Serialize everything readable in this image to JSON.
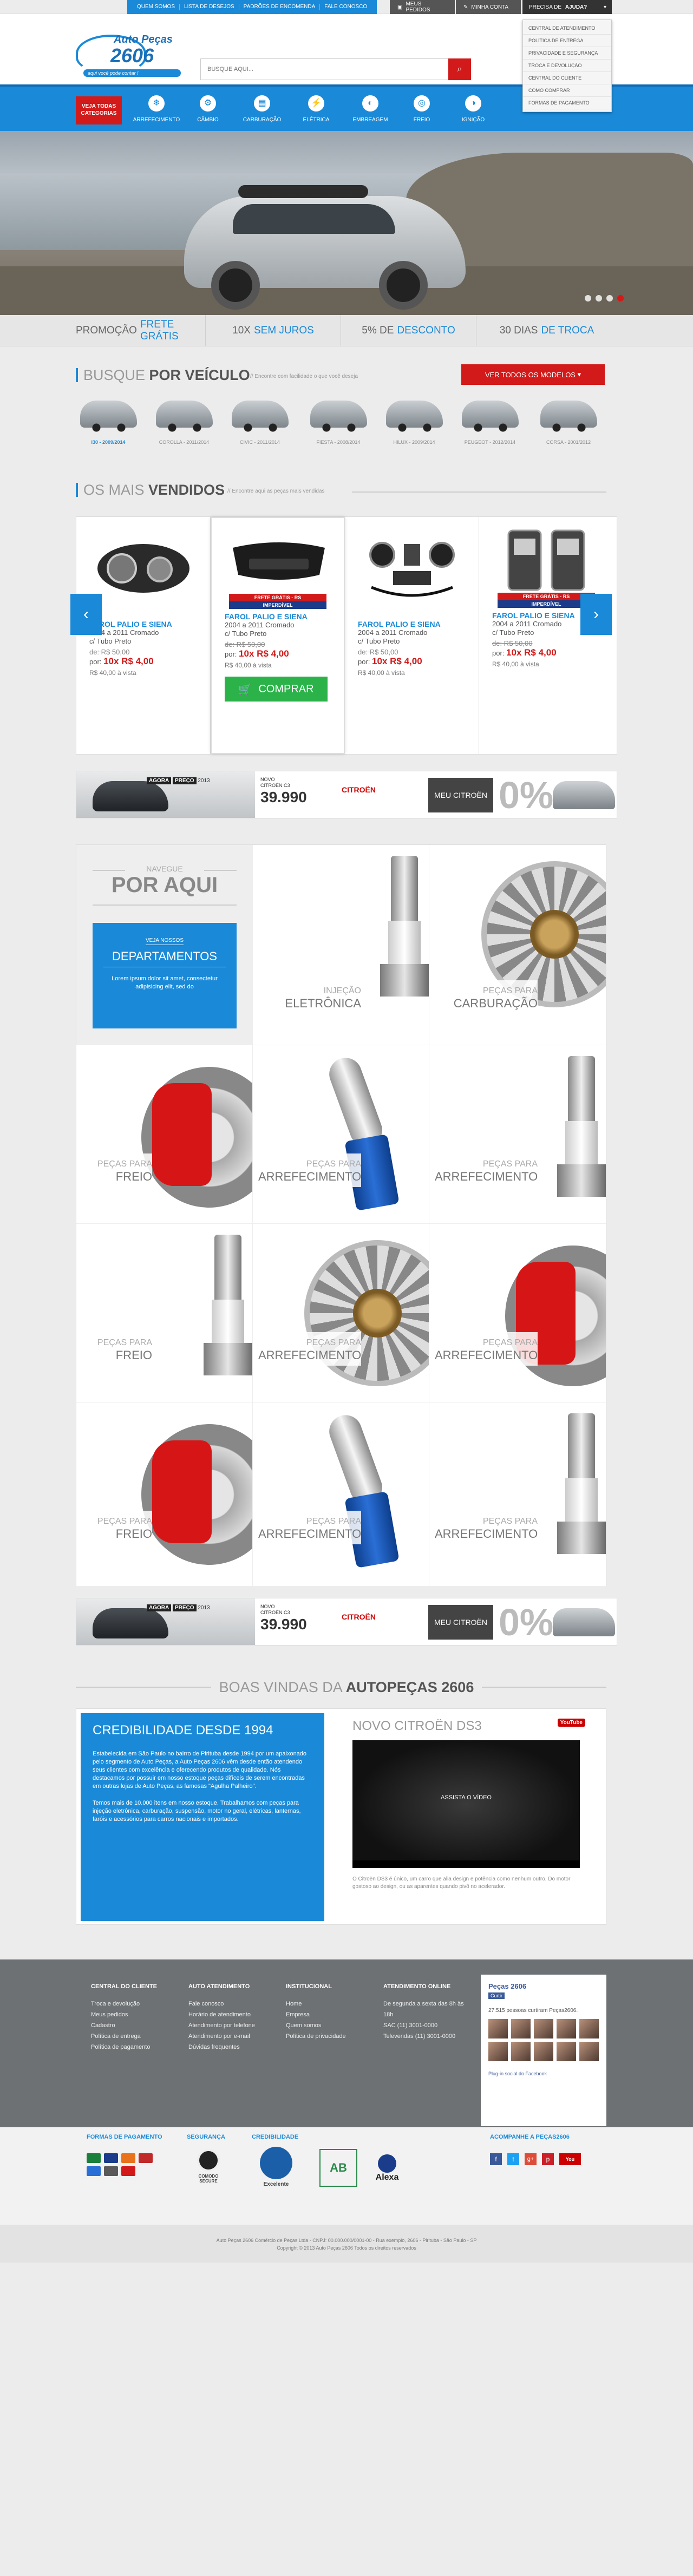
{
  "topbar": {
    "links": [
      "QUEM SOMOS",
      "LISTA DE DESEJOS",
      "PADRÕES DE ENCOMENDA",
      "FALE CONOSCO"
    ],
    "my_orders": "MEUS PEDIDOS",
    "my_account": "MINHA CONTA",
    "help_prefix": "PRECISA DE",
    "help_bold": "AJUDA?",
    "help_menu": [
      "CENTRAL DE ATENDIMENTO",
      "POLÍTICA DE ENTREGA",
      "PRIVACIDADE E SEGURANÇA",
      "TROCA E DEVOLUÇÃO",
      "CENTRAL DO CLIENTE",
      "COMO COMPRAR",
      "FORMAS DE PAGAMENTO"
    ]
  },
  "logo": {
    "line1": "Auto Peças",
    "line2": "2606",
    "tagline": "aqui você pode contar !"
  },
  "search": {
    "placeholder": "BUSQUE AQUI..."
  },
  "nav": {
    "categories": "VEJA TODAS CATEGORIAS",
    "items": [
      "ARREFECIMENTO",
      "CÂMBIO",
      "CARBURAÇÃO",
      "ELÉTRICA",
      "EMBREAGEM",
      "FREIO",
      "IGNIÇÃO"
    ]
  },
  "promo": [
    {
      "text": "PROMOÇÃO",
      "accent": "FRETE GRÁTIS"
    },
    {
      "text": "10X",
      "accent": "SEM JUROS"
    },
    {
      "text": "5% DE",
      "accent": "DESCONTO"
    },
    {
      "text": "30 DIAS",
      "accent": "DE TROCA"
    }
  ],
  "vehicle": {
    "title_light": "BUSQUE",
    "title_bold": "POR VEÍCULO",
    "subtitle": "// Encontre com facilidade o que você deseja",
    "button": "VER TODOS OS MODELOS",
    "models": [
      "I30 - 2009/2014",
      "COROLLA - 2011/2014",
      "CIVIC - 2011/2014",
      "FIESTA - 2008/2014",
      "HILUX - 2009/2014",
      "PEUGEOT - 2012/2014",
      "CORSA - 2001/2012"
    ]
  },
  "bestsellers": {
    "title_light": "OS MAIS",
    "title_bold": "VENDIDOS",
    "subtitle": "// Encontre aqui as peças mais vendidas",
    "products": [
      {
        "name": "FAROL PALIO E SIENA",
        "desc1": "2004 a 2011 Cromado",
        "desc2": "c/ Tubo Preto",
        "old": "de: R$ 50,00",
        "new_prefix": "por:",
        "new": "10x R$ 4,00",
        "inst": "R$ 40,00 à vista",
        "badge": ""
      },
      {
        "name": "FAROL PALIO E SIENA",
        "desc1": "2004 a 2011 Cromado",
        "desc2": "c/ Tubo Preto",
        "old": "de: R$ 50,00",
        "new_prefix": "por:",
        "new": "10x R$ 4,00",
        "inst": "R$ 40,00 à vista",
        "badge": "FRETE GRÁTIS - RS",
        "badge2": "IMPERDÍVEL",
        "buy": "COMPRAR"
      },
      {
        "name": "FAROL PALIO E SIENA",
        "desc1": "2004 a 2011 Cromado",
        "desc2": "c/ Tubo Preto",
        "old": "de: R$ 50,00",
        "new_prefix": "por:",
        "new": "10x R$ 4,00",
        "inst": "R$ 40,00 à vista",
        "badge": ""
      },
      {
        "name": "FAROL PALIO E SIENA",
        "desc1": "2004 a 2011 Cromado",
        "desc2": "c/ Tubo Preto",
        "old": "de: R$ 50,00",
        "new_prefix": "por:",
        "new": "10x R$ 4,00",
        "inst": "R$ 40,00 à vista",
        "badge": "FRETE GRÁTIS - RS",
        "badge2": "IMPERDÍVEL"
      }
    ]
  },
  "banner": {
    "agora": "AGORA",
    "preco": "PREÇO",
    "ano": "2013",
    "novo": "NOVO",
    "model": "CITROËN C3",
    "price": "39.990",
    "brand": "CITROËN",
    "shop": "MEU CITROËN",
    "zero": "0%"
  },
  "departments": {
    "nav_small": "NAVEGUE",
    "nav_big": "POR AQUI",
    "box_small": "VEJA NOSSOS",
    "box_big": "DEPARTAMENTOS",
    "box_text": "Lorem ipsum dolor sit amet, consectetur adipisicing elit, sed do",
    "tiles": [
      {
        "small": "INJEÇÃO",
        "big": "ELETRÔNICA"
      },
      {
        "small": "PEÇAS PARA",
        "big": "CARBURAÇÃO"
      },
      {
        "small": "PEÇAS PARA",
        "big": "FREIO"
      },
      {
        "small": "PEÇAS PARA",
        "big": "ARREFECIMENTO"
      },
      {
        "small": "PEÇAS PARA",
        "big": "ARREFECIMENTO"
      },
      {
        "small": "PEÇAS PARA",
        "big": "FREIO"
      },
      {
        "small": "PEÇAS PARA",
        "big": "ARREFECIMENTO"
      },
      {
        "small": "PEÇAS PARA",
        "big": "ARREFECIMENTO"
      },
      {
        "small": "PEÇAS PARA",
        "big": "FREIO"
      },
      {
        "small": "PEÇAS PARA",
        "big": "ARREFECIMENTO"
      },
      {
        "small": "PEÇAS PARA",
        "big": "ARREFECIMENTO"
      }
    ]
  },
  "welcome": {
    "light": "BOAS VINDAS DA",
    "bold": "AUTOPEÇAS 2606"
  },
  "about": {
    "title": "CREDIBILIDADE DESDE 1994",
    "p1": "Estabelecida em São Paulo no bairro de Pirituba desde 1994 por um apaixonado pelo segmento de Auto Peças, a Auto Peças 2606 vêm desde então atendendo seus clientes com excelência e oferecendo produtos de qualidade. Nós destacamos por possuir em nosso estoque peças difíceis de serem encontradas em outras lojas de Auto Peças, as famosas \"Agulha Palheiro\".",
    "p2": "Temos mais de 10.000 itens em nosso estoque. Trabalhamos com peças para injeção eletrônica, carburação, suspensão, motor no geral, elétricas, lanternas, faróis e acessórios para carros nacionais e importados.",
    "video_title": "NOVO CITROËN DS3",
    "video_badge": "YouTube",
    "video_caption": "ASSISTA O VÍDEO",
    "video_text": "O Citroën DS3 é único, um carro que alia design e potência como nenhum outro. Do motor gostoso ao design, ou as aparentes quando pivô no acelerador."
  },
  "footer": {
    "cols": [
      {
        "title": "CENTRAL DO CLIENTE",
        "items": [
          "Troca e devolução",
          "Meus pedidos",
          "Cadastro",
          "Política de entrega",
          "Política de pagamento"
        ]
      },
      {
        "title": "AUTO ATENDIMENTO",
        "items": [
          "Fale conosco",
          "Horário de atendimento",
          "Atendimento por telefone",
          "Atendimento por e-mail",
          "Dúvidas frequentes"
        ]
      },
      {
        "title": "INSTITUCIONAL",
        "items": [
          "Home",
          "Empresa",
          "Quem somos",
          "Política de privacidade"
        ]
      },
      {
        "title": "ATENDIMENTO ONLINE",
        "items": [
          "De segunda a sexta das 8h às 18h",
          "SAC (11) 3001-0000",
          "Televendas (11) 3001-0000"
        ]
      }
    ],
    "fb_name": "Peças 2606",
    "fb_like": "Curtir",
    "fb_count": "27.515 pessoas curtiram Peças2606.",
    "fb_plugin": "Plug-in social do Facebook",
    "social_title": "ACOMPANHE A PEÇAS2606"
  },
  "bottom": {
    "pay_title": "FORMAS DE PAGAMENTO",
    "sec_title": "SEGURANÇA",
    "cred_title": "CREDIBILIDADE",
    "seals": [
      "COMODO SECURE",
      "Excelente",
      "AB",
      "Alexa"
    ],
    "copy1": "Auto Peças 2606 Comércio de Peças Ltda - CNPJ: 00.000.000/0001-00 - Rua exemplo, 2606 - Pirituba - São Paulo - SP",
    "copy2": "Copyright © 2013 Auto Peças 2606 Todos os direitos reservados"
  }
}
